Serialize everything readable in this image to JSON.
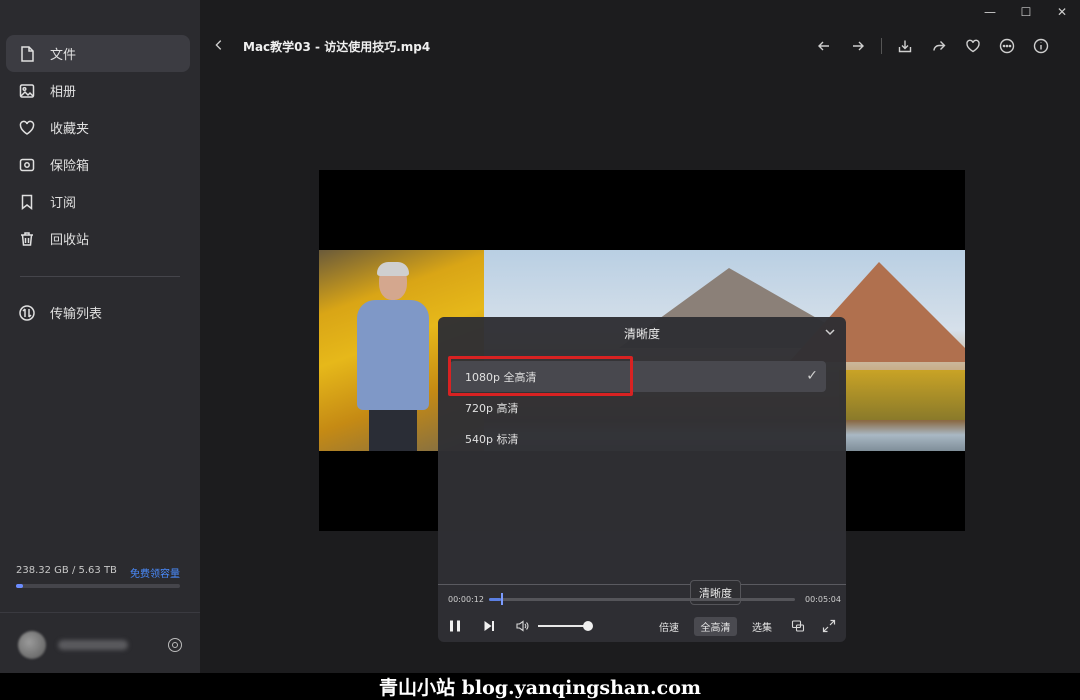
{
  "window": {
    "minimize": "—",
    "maximize": "☐",
    "close": "✕"
  },
  "sidebar": {
    "items": [
      {
        "label": "文件",
        "icon": "file-icon",
        "active": true
      },
      {
        "label": "相册",
        "icon": "image-icon"
      },
      {
        "label": "收藏夹",
        "icon": "heart-icon"
      },
      {
        "label": "保险箱",
        "icon": "safe-icon"
      },
      {
        "label": "订阅",
        "icon": "bookmark-icon"
      },
      {
        "label": "回收站",
        "icon": "trash-icon"
      }
    ],
    "transfer": {
      "label": "传输列表",
      "icon": "transfer-icon"
    },
    "storage": {
      "used": "238.32 GB / 5.63 TB",
      "upgrade": "免费领容量",
      "fraction": 0.04
    }
  },
  "header": {
    "back_icon": "chevron-left-icon",
    "title": "Mac教学03 - 访达使用技巧.mp4",
    "actions": [
      "arrow-left-icon",
      "arrow-right-icon",
      "download-icon",
      "share-icon",
      "heart-icon",
      "more-icon",
      "info-icon"
    ]
  },
  "quality_panel": {
    "title": "清晰度",
    "options": [
      {
        "label": "1080p 全高清",
        "selected": true
      },
      {
        "label": "720p 高清",
        "selected": false
      },
      {
        "label": "540p 标清",
        "selected": false
      }
    ],
    "check": "✓"
  },
  "player": {
    "tooltip": "清晰度",
    "time_current": "00:00:12",
    "time_total": "00:05:04",
    "progress": 0.04,
    "volume": 0.9,
    "speed_label": "倍速",
    "quality_label": "全高清",
    "episodes_label": "选集"
  },
  "watermark": "青山小站 blog.yanqingshan.com",
  "colors": {
    "accent": "#5b7fe3",
    "highlight": "#d82222",
    "link": "#4a8cff"
  }
}
